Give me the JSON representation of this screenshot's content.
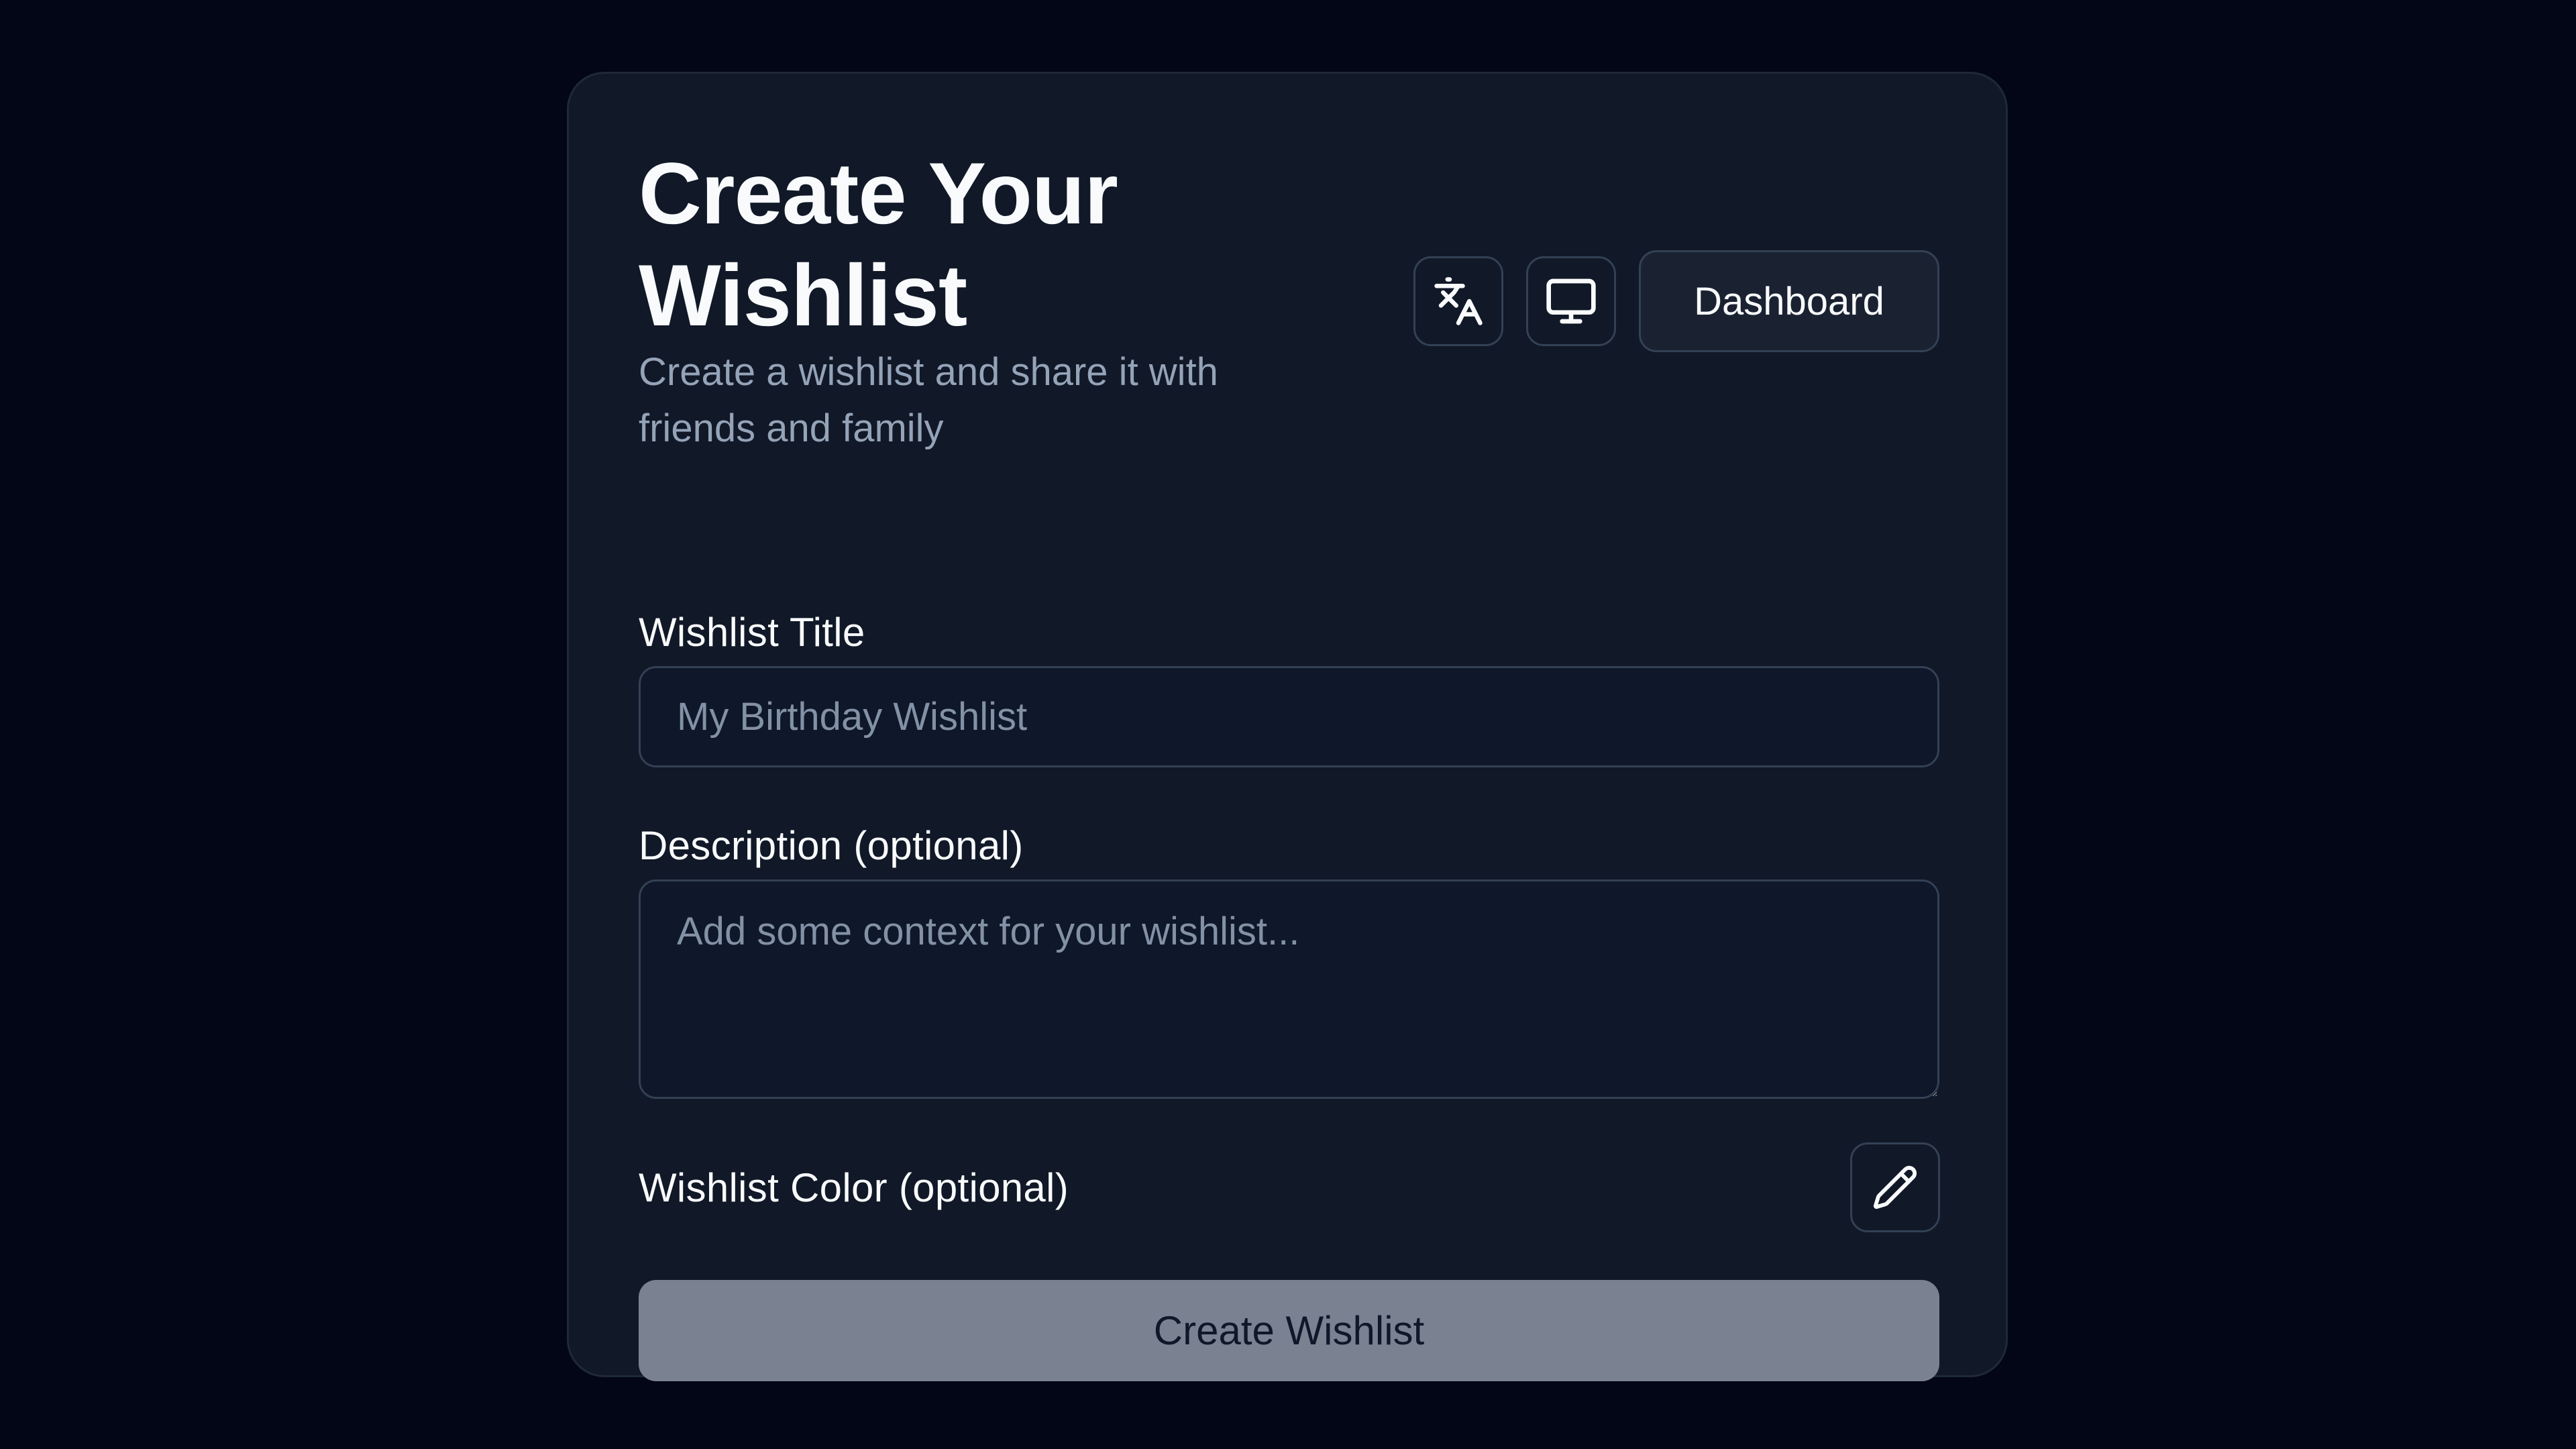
{
  "header": {
    "title": "Create Your Wishlist",
    "subtitle": "Create a wishlist and share it with friends and family",
    "language_icon": "translate-icon",
    "theme_icon": "monitor-icon",
    "dashboard_label": "Dashboard"
  },
  "form": {
    "title_label": "Wishlist Title",
    "title_placeholder": "My Birthday Wishlist",
    "title_value": "",
    "description_label": "Description (optional)",
    "description_placeholder": "Add some context for your wishlist...",
    "description_value": "",
    "color_label": "Wishlist Color (optional)",
    "color_icon": "pencil-icon",
    "submit_label": "Create Wishlist",
    "submit_disabled": true
  },
  "colors": {
    "page_background": "#020617",
    "card_background": "#111827",
    "muted_text": "#94a3b8",
    "disabled_button": "#7a8190"
  }
}
